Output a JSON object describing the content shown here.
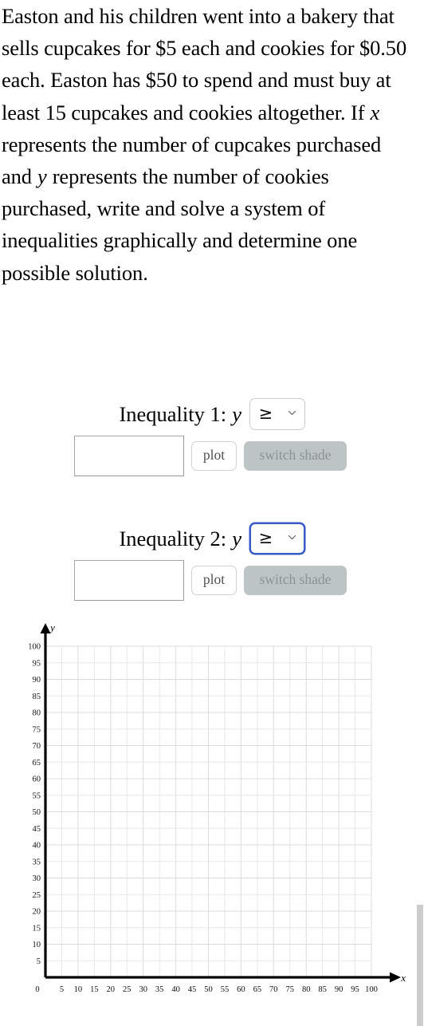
{
  "problem": {
    "segments": [
      {
        "t": "Easton and his children went into a bakery that sells cupcakes for $5 each and cookies for $0.50 each. Easton has $50 to spend and must buy at least 15 cupcakes and cookies altogether. If ",
        "style": "plain"
      },
      {
        "t": "x",
        "style": "math"
      },
      {
        "t": " represents the number of cupcakes purchased and ",
        "style": "plain"
      },
      {
        "t": "y",
        "style": "math"
      },
      {
        "t": " represents the number of cookies purchased, write and solve a system of inequalities graphically and determine one possible solution.",
        "style": "plain"
      }
    ],
    "full_text": "Easton and his children went into a bakery that sells cupcakes for $5 each and cookies for $0.50 each. Easton has $50 to spend and must buy at least 15 cupcakes and cookies altogether. If x represents the number of cupcakes purchased and y represents the number of cookies purchased, write and solve a system of inequalities graphically and determine one possible solution."
  },
  "inequality1": {
    "label": "Inequality 1:",
    "variable": "y",
    "operator_selected": "≥",
    "operator_options": [
      "≥",
      "≤",
      ">",
      "<"
    ],
    "expression_value": "",
    "expression_placeholder": "",
    "plot_label": "plot",
    "switch_label": "switch shade",
    "focused": false
  },
  "inequality2": {
    "label": "Inequality 2:",
    "variable": "y",
    "operator_selected": "≥",
    "operator_options": [
      "≥",
      "≤",
      ">",
      "<"
    ],
    "expression_value": "",
    "expression_placeholder": "",
    "plot_label": "plot",
    "switch_label": "switch shade",
    "focused": true
  },
  "chart_data": {
    "type": "scatter",
    "title": "",
    "xlabel": "x",
    "ylabel": "y",
    "xlim": [
      0,
      100
    ],
    "ylim": [
      0,
      100
    ],
    "x_ticks": [
      0,
      5,
      10,
      15,
      20,
      25,
      30,
      35,
      40,
      45,
      50,
      55,
      60,
      65,
      70,
      75,
      80,
      85,
      90,
      95,
      100
    ],
    "y_ticks": [
      5,
      10,
      15,
      20,
      25,
      30,
      35,
      40,
      45,
      50,
      55,
      60,
      65,
      70,
      75,
      80,
      85,
      90,
      95,
      100
    ],
    "origin_label": "0",
    "grid": true,
    "grid_step": 5,
    "grid_major_step": 10,
    "series": [],
    "values": [],
    "legend": [],
    "annotations": [],
    "axis_arrows": true,
    "grid_color": "#e8e8e8",
    "grid_major_color": "#dcdcdc",
    "axis_color": "#000000"
  },
  "colors": {
    "focus_blue": "#3a5bc7",
    "switch_bg": "#bcc4c4",
    "switch_text": "#8d9294",
    "button_border": "#cfd2d6",
    "input_border": "#9a9a9a",
    "scrollbar_thumb": "#cdcdcd"
  }
}
